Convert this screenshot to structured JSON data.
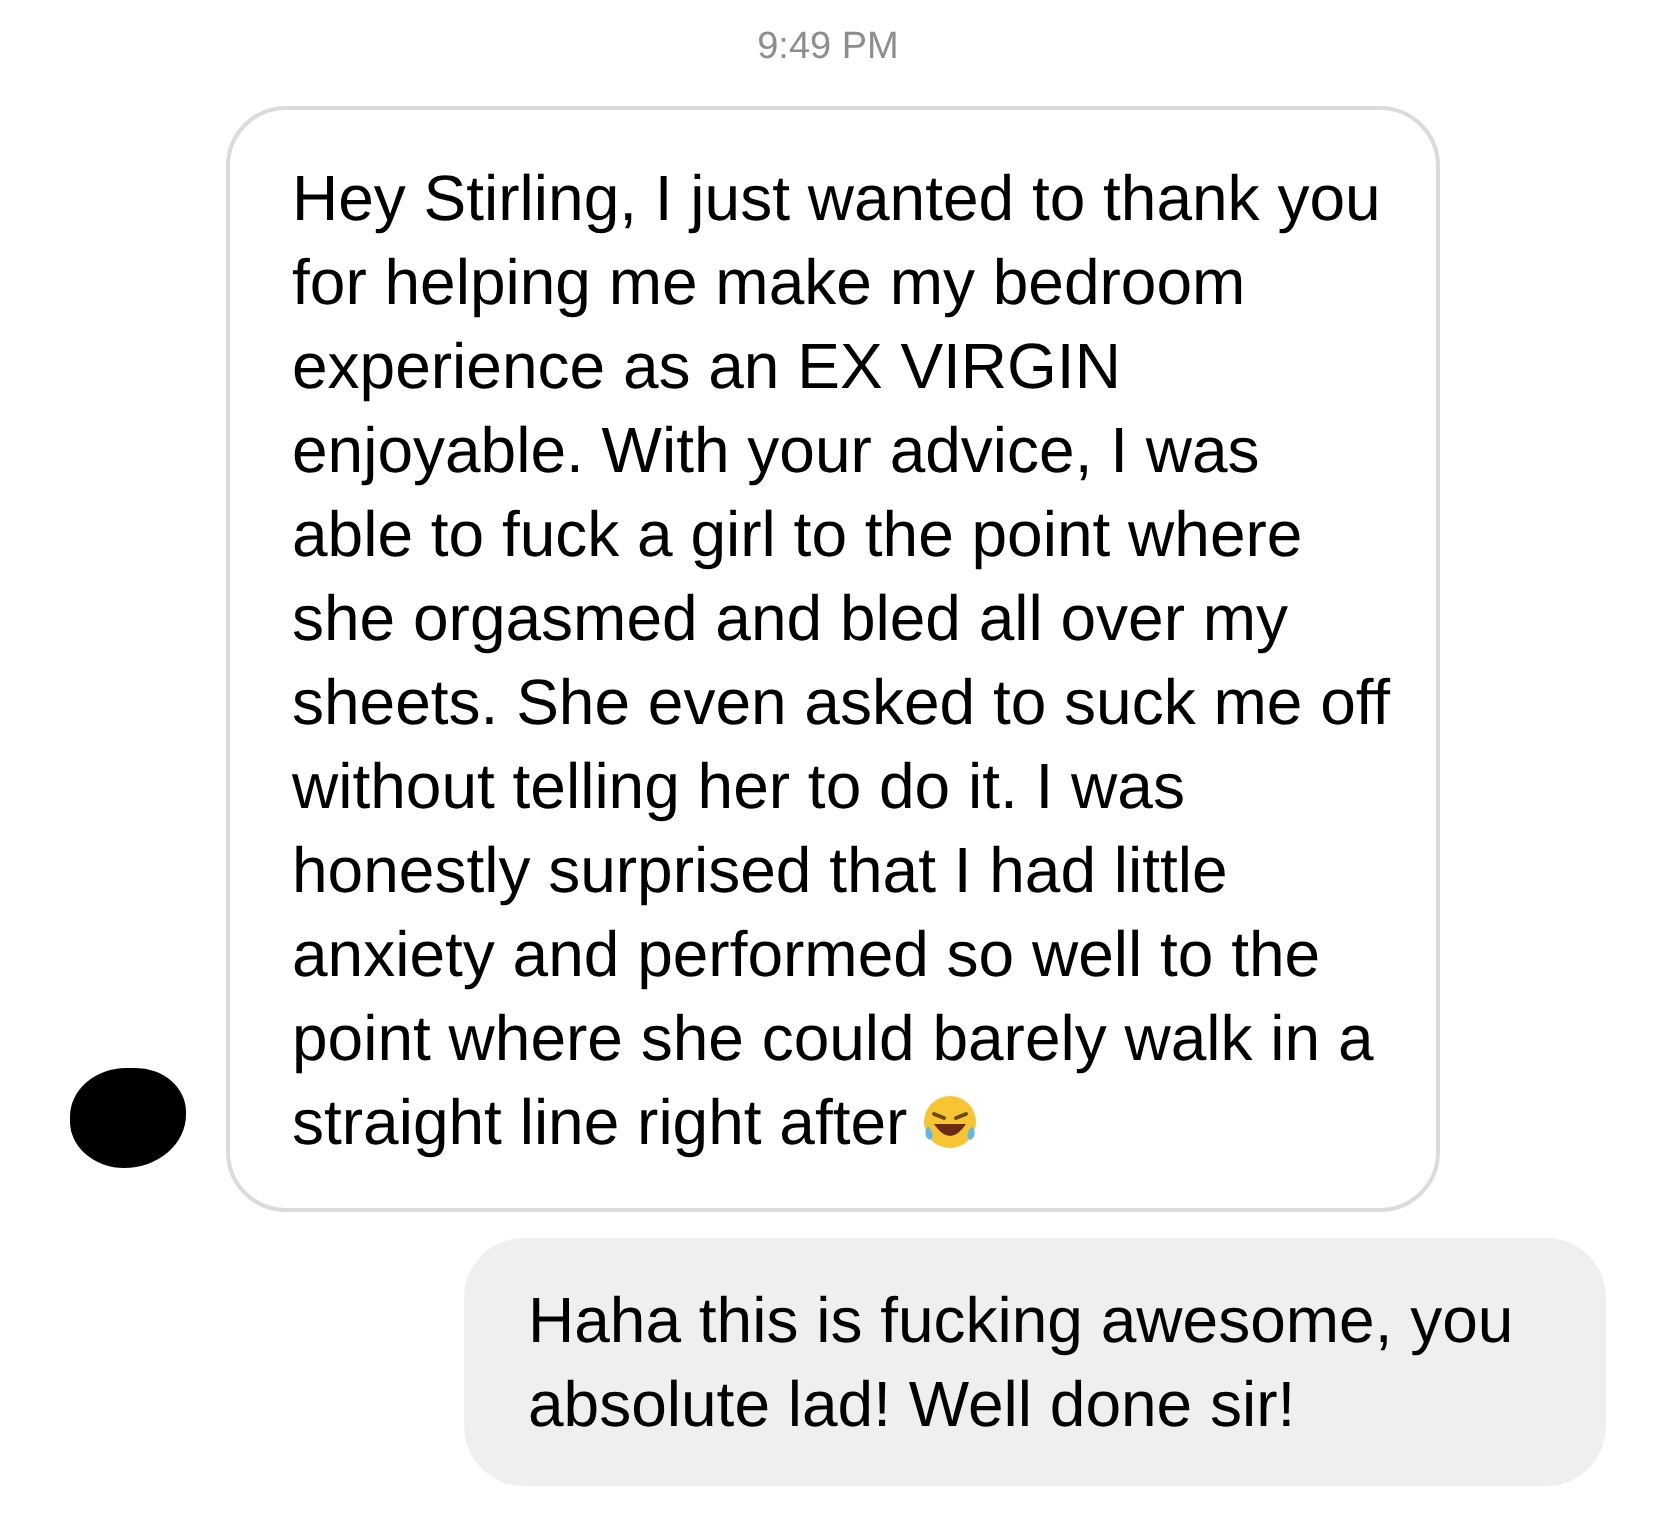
{
  "timestamp": "9:49 PM",
  "messages": [
    {
      "kind": "incoming",
      "text": "Hey Stirling, I just wanted to thank you for helping me make my bedroom experience as an EX VIRGIN enjoyable. With your advice, I was able to fuck a girl to the point where she orgasmed and bled all over my sheets. She even asked to suck me off without telling her to do it. I was honestly surprised that I had little anxiety and performed so well to the point where she could barely walk in a straight line right after",
      "emoji": true
    },
    {
      "kind": "outgoing",
      "text": "Haha this is fucking awesome, you absolute lad! Well done sir!",
      "emoji": false
    }
  ]
}
